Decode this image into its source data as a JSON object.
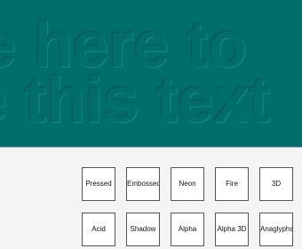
{
  "preview": {
    "line1": "e here to",
    "line2": "e this text",
    "background_color": "#006e69"
  },
  "effects": {
    "pressed": "Pressed",
    "embossed": "Embossed",
    "neon": "Neon",
    "fire": "Fire",
    "three_d": "3D",
    "acid": "Acid",
    "shadow": "Shadow",
    "alpha": "Alpha",
    "alpha_3d": "Alpha 3D",
    "anaglyphs": "Anaglyphs"
  },
  "colors": {
    "divider": "#b792c9",
    "panel_background": "#f4f4f4"
  }
}
